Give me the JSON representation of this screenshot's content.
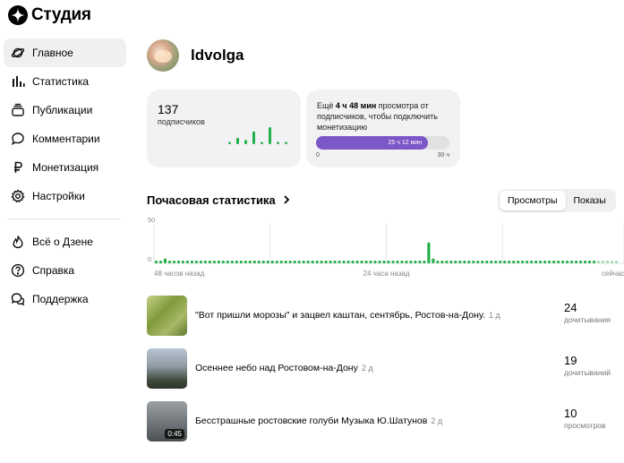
{
  "app": {
    "title": "Студия"
  },
  "sidebar": {
    "items": [
      {
        "label": "Главное",
        "icon": "planet-icon",
        "active": true
      },
      {
        "label": "Статистика",
        "icon": "stats-bars-icon"
      },
      {
        "label": "Публикации",
        "icon": "publications-stack-icon"
      },
      {
        "label": "Комментарии",
        "icon": "comment-bubble-icon"
      },
      {
        "label": "Монетизация",
        "icon": "ruble-icon"
      },
      {
        "label": "Настройки",
        "icon": "gear-icon"
      }
    ],
    "secondary_items": [
      {
        "label": "Всё о Дзене",
        "icon": "flame-icon"
      },
      {
        "label": "Справка",
        "icon": "question-circle-icon"
      },
      {
        "label": "Поддержка",
        "icon": "support-chat-icon"
      }
    ]
  },
  "profile": {
    "username": "ldvolga"
  },
  "subscribers": {
    "value": "137",
    "label": "подписчиков",
    "trend_values": [
      1,
      3,
      2,
      6,
      1,
      8,
      1,
      1
    ]
  },
  "monetization": {
    "text_prefix": "Ещё ",
    "text_bold": "4 ч 48 мин",
    "text_suffix": " просмотра от подписчиков, чтобы подключить монетизацию",
    "progress_label": "25 ч 12 мин",
    "progress_fraction": 0.84,
    "scale_min": "0",
    "scale_max": "30 ч"
  },
  "hourly": {
    "title": "Почасовая статистика",
    "tabs": [
      {
        "label": "Просмотры",
        "active": true
      },
      {
        "label": "Показы",
        "active": false
      }
    ]
  },
  "chart_data": {
    "type": "bar",
    "ylim": [
      0,
      50
    ],
    "y_ticks": [
      "50",
      "0"
    ],
    "x_tick_labels": [
      "48 часов назад",
      "24 часа назад",
      "сейчас"
    ],
    "values": [
      1,
      2,
      6,
      2,
      1,
      1,
      2,
      1,
      1,
      1,
      1,
      1,
      1,
      1,
      1,
      1,
      1,
      1,
      1,
      1,
      1,
      1,
      1,
      1,
      1,
      1,
      1,
      1,
      1,
      1,
      1,
      1,
      1,
      1,
      1,
      1,
      1,
      1,
      1,
      2,
      1,
      1,
      1,
      1,
      1,
      1,
      1,
      1,
      1,
      1,
      1,
      1,
      1,
      1,
      1,
      1,
      1,
      1,
      1,
      1,
      1,
      26,
      6,
      2,
      1,
      1,
      1,
      1,
      1,
      1,
      1,
      1,
      1,
      1,
      1,
      1,
      1,
      1,
      1,
      1,
      1,
      1,
      1,
      1,
      1,
      1,
      1,
      1,
      1,
      3,
      1,
      1,
      1,
      1,
      1,
      1,
      1,
      1,
      1,
      1,
      1,
      1,
      1,
      1
    ],
    "dim_tail_count": 5,
    "bar_color": "#22b14c",
    "dim_color": "#a6d9b2"
  },
  "videos": [
    {
      "title": "\"Вот пришли морозы\" и зацвел каштан, сентябрь, Ростов-на-Дону.",
      "age": "1 д",
      "stat_value": "24",
      "stat_label": "дочитывания",
      "duration": ""
    },
    {
      "title": "Осеннее небо над Ростовом-на-Дону",
      "age": "2 д",
      "stat_value": "19",
      "stat_label": "дочитываний",
      "duration": ""
    },
    {
      "title": "Бесстрашные ростовские голуби Музыка Ю.Шатунов",
      "age": "2 д",
      "stat_value": "10",
      "stat_label": "просмотров",
      "duration": "0:45"
    }
  ]
}
